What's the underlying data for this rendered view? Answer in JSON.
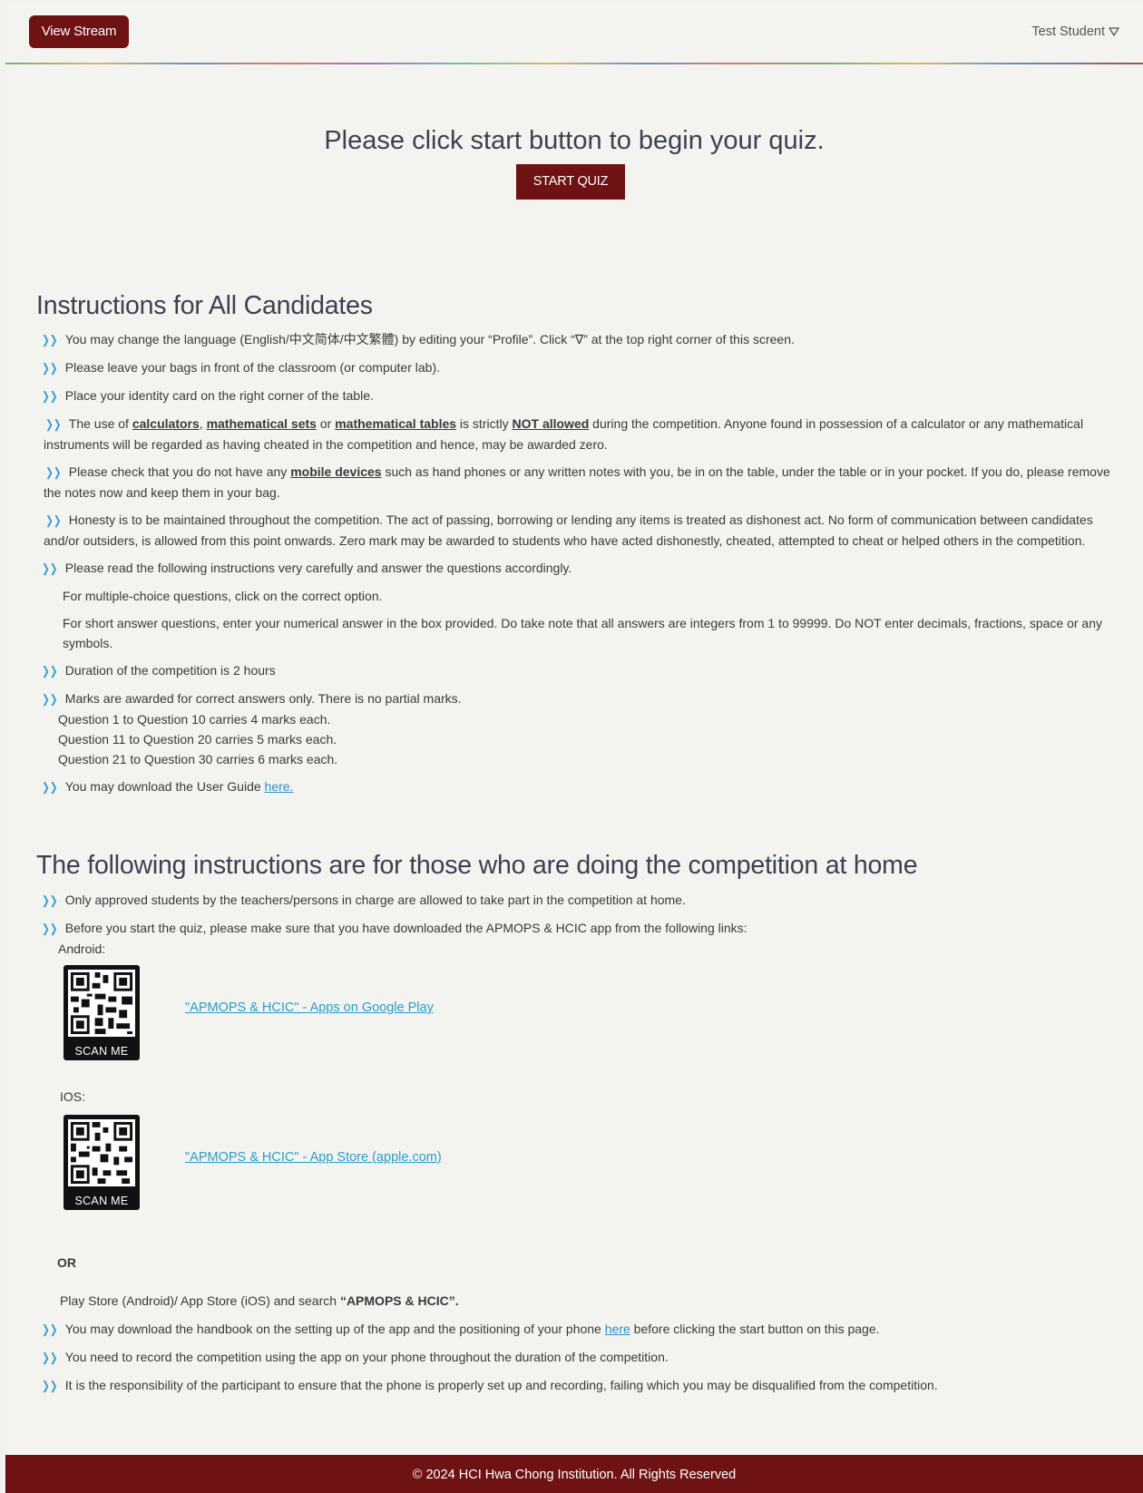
{
  "header": {
    "view_stream_label": "View Stream",
    "user_name": "Test Student"
  },
  "start": {
    "title": "Please click start button to begin your quiz.",
    "button_label": "START QUIZ"
  },
  "section1": {
    "title": "Instructions for All Candidates",
    "item1": "You may change the language (English/中文简体/中文繁體) by editing your “Profile”. Click “∇” at the top right corner of this screen.",
    "item2": "Please leave your bags in front of the classroom (or computer lab).",
    "item3": "Place your identity card on the right corner of the table.",
    "item4": {
      "p1": "The use of ",
      "b1": "calculators",
      "p2": ", ",
      "b2": "mathematical sets",
      "p3": " or ",
      "b3": "mathematical tables",
      "p4": " is strictly ",
      "b4": "NOT allowed",
      "p5": " during the competition. Anyone found in possession of a calculator or any mathematical instruments will be regarded as having cheated in the competition and hence, may be awarded zero."
    },
    "item5": {
      "p1": "Please check that you do not have any ",
      "b1": "mobile devices",
      "p2": " such as hand phones or any written notes with you, be in on the table, under the table or in your pocket. If you do, please remove the notes now and keep them in your bag."
    },
    "item6": "Honesty is to be maintained throughout the competition. The act of passing, borrowing or lending any items is treated as dishonest act. No form of communication between candidates and/or outsiders, is allowed from this point onwards. Zero mark may be awarded to students who have acted dishonestly, cheated, attempted to cheat or helped others in the competition.",
    "item7": {
      "main": "Please read the following instructions very carefully and answer the questions accordingly.",
      "mcq": "For multiple-choice questions, click on the correct option.",
      "short": "For short answer questions, enter your numerical answer in the box provided. Do take note that all answers are integers from 1 to 99999. Do NOT enter decimals, fractions, space or any symbols."
    },
    "item8": "Duration of the competition is 2 hours",
    "item9": {
      "main": "Marks are awarded for correct answers only. There is no partial marks.",
      "l1": "Question 1 to Question 10 carries 4 marks each.",
      "l2": "Question 11 to Question 20 carries 5 marks each.",
      "l3": "Question 21 to Question 30 carries 6 marks each."
    },
    "item10": {
      "text": "You may download the User Guide ",
      "link": "here."
    }
  },
  "section2": {
    "title": "The following instructions are for those who are doing the competition at home",
    "item1": "Only approved students by the teachers/persons in charge are allowed to take part in the competition at home.",
    "item2": {
      "main": "Before you start the quiz, please make sure that you have downloaded the APMOPS & HCIC app from the following links:",
      "android": "Android:"
    },
    "qr_label": "SCAN ME",
    "android_link": "\"APMOPS & HCIC\" - Apps on Google Play",
    "ios_label": "IOS:",
    "ios_link": "\"APMOPS & HCIC\" - App Store (apple.com)",
    "or_label": "OR",
    "play_line": {
      "text": "Play Store (Android)/ App Store (iOS) and search ",
      "bold": "“APMOPS & HCIC”."
    },
    "item3": {
      "p1": "You may download the handbook on the setting up of the app and the positioning of your phone ",
      "link": "here",
      "p2": " before clicking the start button on this page."
    },
    "item4": "You need to record the competition using the app on your phone throughout the duration of the competition.",
    "item5": "It is the responsibility of the participant to ensure that the phone is properly set up and recording, failing which you may be disqualified from the competition."
  },
  "footer": {
    "text": "© 2024 HCI Hwa Chong Institution. All Rights Reserved"
  },
  "colors": {
    "brand": "#6e1213",
    "link": "#2a9ec7",
    "bullet": "#3aa0c9"
  }
}
